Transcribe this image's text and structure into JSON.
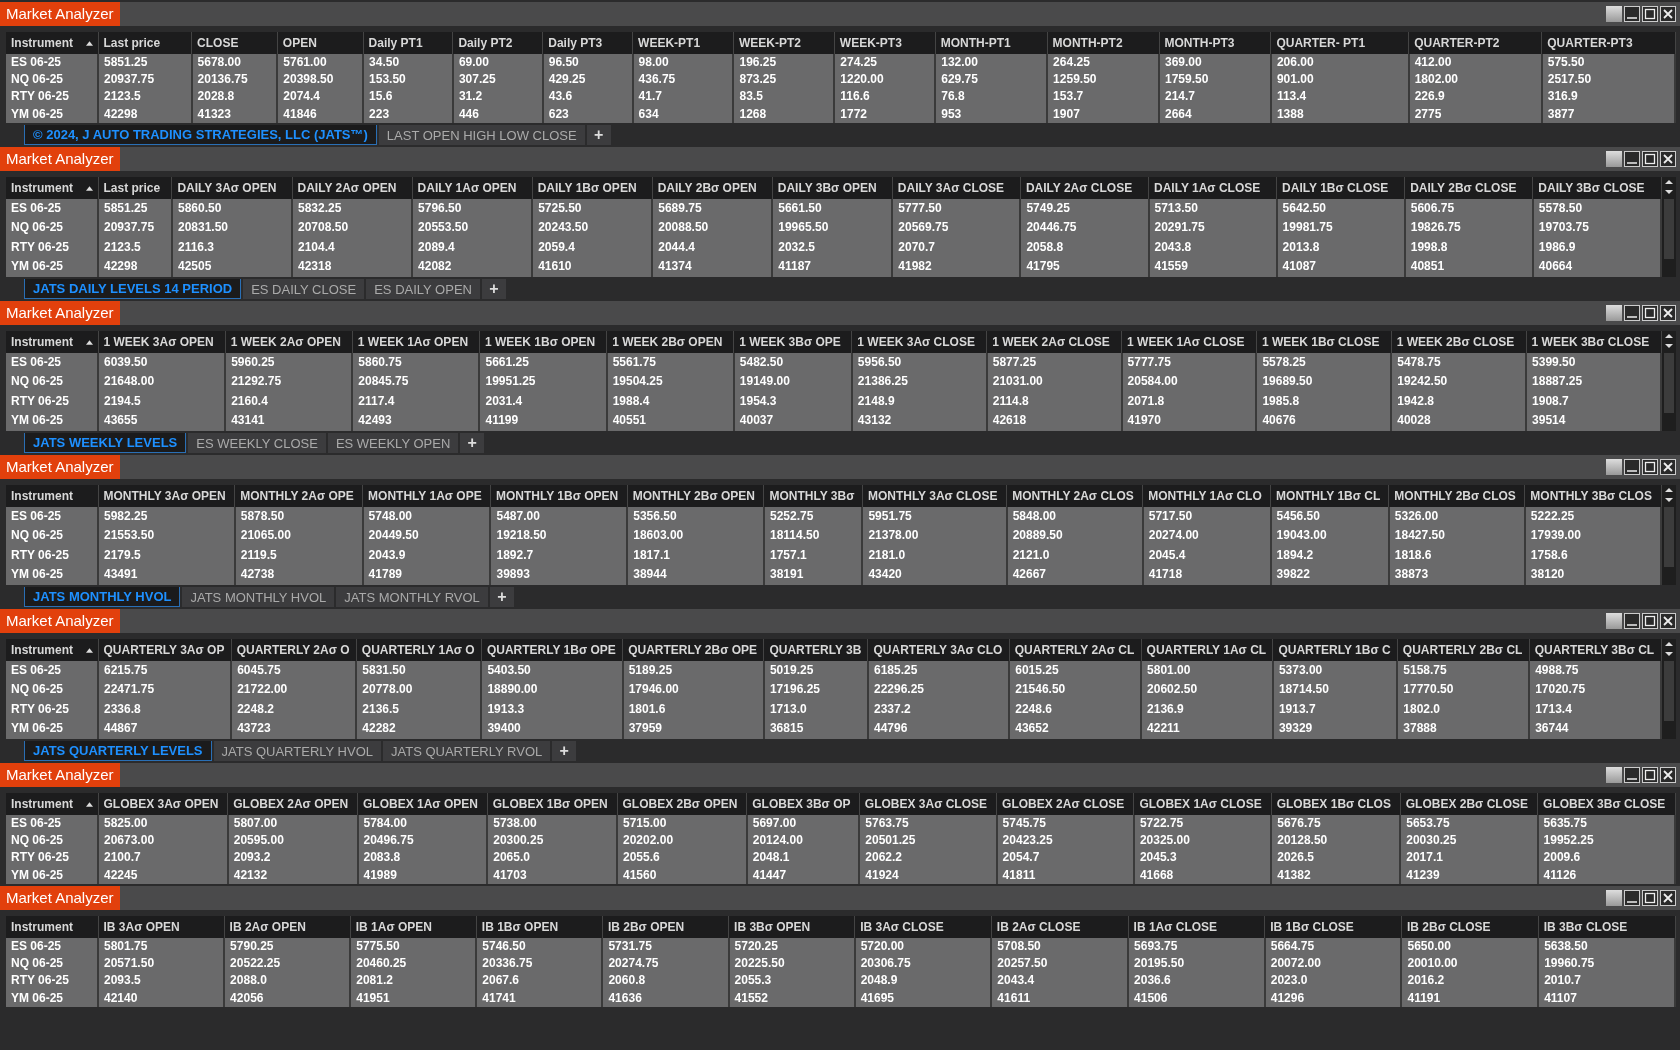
{
  "panels": [
    {
      "title": "Market Analyzer",
      "sorted": true,
      "scrollbar": false,
      "columns": [
        "Instrument",
        "Last price",
        "CLOSE",
        "OPEN",
        "Daily PT1",
        "Daily PT2",
        "Daily PT3",
        "WEEK-PT1",
        "WEEK-PT2",
        "WEEK-PT3",
        "MONTH-PT1",
        "MONTH-PT2",
        "MONTH-PT3",
        "QUARTER- PT1",
        "QUARTER-PT2",
        "QUARTER-PT3"
      ],
      "rows": [
        [
          "ES 06-25",
          "5851.25",
          "5678.00",
          "5761.00",
          "34.50",
          "69.00",
          "96.50",
          "98.00",
          "196.25",
          "274.25",
          "132.00",
          "264.25",
          "369.00",
          "206.00",
          "412.00",
          "575.50"
        ],
        [
          "NQ 06-25",
          "20937.75",
          "20136.75",
          "20398.50",
          "153.50",
          "307.25",
          "429.25",
          "436.75",
          "873.25",
          "1220.00",
          "629.75",
          "1259.50",
          "1759.50",
          "901.00",
          "1802.00",
          "2517.50"
        ],
        [
          "RTY 06-25",
          "2123.5",
          "2028.8",
          "2074.4",
          "15.6",
          "31.2",
          "43.6",
          "41.7",
          "83.5",
          "116.6",
          "76.8",
          "153.7",
          "214.7",
          "113.4",
          "226.9",
          "316.9"
        ],
        [
          "YM 06-25",
          "42298",
          "41323",
          "41846",
          "223",
          "446",
          "623",
          "634",
          "1268",
          "1772",
          "953",
          "1907",
          "2664",
          "1388",
          "2775",
          "3877"
        ]
      ],
      "tabs": [
        {
          "label": "© 2024, J AUTO TRADING STRATEGIES, LLC (JATS™)",
          "selected": true
        },
        {
          "label": "LAST OPEN HIGH LOW CLOSE",
          "selected": false
        }
      ],
      "add_tab": "+"
    },
    {
      "title": "Market Analyzer",
      "sorted": true,
      "scrollbar": true,
      "columns": [
        "Instrument",
        "Last price",
        "DAILY 3Aσ OPEN",
        "DAILY 2Aσ OPEN",
        "DAILY 1Aσ OPEN",
        "DAILY 1Bσ OPEN",
        "DAILY 2Bσ OPEN",
        "DAILY 3Bσ OPEN",
        "DAILY 3Aσ CLOSE",
        "DAILY 2Aσ CLOSE",
        "DAILY 1Aσ CLOSE",
        "DAILY 1Bσ CLOSE",
        "DAILY 2Bσ CLOSE",
        "DAILY 3Bσ CLOSE"
      ],
      "rows": [
        [
          "ES 06-25",
          "5851.25",
          "5860.50",
          "5832.25",
          "5796.50",
          "5725.50",
          "5689.75",
          "5661.50",
          "5777.50",
          "5749.25",
          "5713.50",
          "5642.50",
          "5606.75",
          "5578.50"
        ],
        [
          "NQ 06-25",
          "20937.75",
          "20831.50",
          "20708.50",
          "20553.50",
          "20243.50",
          "20088.50",
          "19965.50",
          "20569.75",
          "20446.75",
          "20291.75",
          "19981.75",
          "19826.75",
          "19703.75"
        ],
        [
          "RTY 06-25",
          "2123.5",
          "2116.3",
          "2104.4",
          "2089.4",
          "2059.4",
          "2044.4",
          "2032.5",
          "2070.7",
          "2058.8",
          "2043.8",
          "2013.8",
          "1998.8",
          "1986.9"
        ],
        [
          "YM 06-25",
          "42298",
          "42505",
          "42318",
          "42082",
          "41610",
          "41374",
          "41187",
          "41982",
          "41795",
          "41559",
          "41087",
          "40851",
          "40664"
        ]
      ],
      "tabs": [
        {
          "label": "JATS DAILY LEVELS 14 PERIOD",
          "selected": true
        },
        {
          "label": "ES DAILY CLOSE",
          "selected": false
        },
        {
          "label": "ES DAILY OPEN",
          "selected": false
        }
      ],
      "add_tab": "+"
    },
    {
      "title": "Market Analyzer",
      "sorted": true,
      "scrollbar": true,
      "columns": [
        "Instrument",
        "1 WEEK 3Aσ OPEN",
        "1 WEEK 2Aσ OPEN",
        "1 WEEK 1Aσ OPEN",
        "1 WEEK 1Bσ OPEN",
        "1 WEEK 2Bσ OPEN",
        "1 WEEK 3Bσ OPE",
        "1 WEEK 3Aσ CLOSE",
        "1 WEEK 2Aσ CLOSE",
        "1 WEEK 1Aσ CLOSE",
        "1 WEEK 1Bσ CLOSE",
        "1 WEEK 2Bσ CLOSE",
        "1 WEEK 3Bσ CLOSE"
      ],
      "rows": [
        [
          "ES 06-25",
          "6039.50",
          "5960.25",
          "5860.75",
          "5661.25",
          "5561.75",
          "5482.50",
          "5956.50",
          "5877.25",
          "5777.75",
          "5578.25",
          "5478.75",
          "5399.50"
        ],
        [
          "NQ 06-25",
          "21648.00",
          "21292.75",
          "20845.75",
          "19951.25",
          "19504.25",
          "19149.00",
          "21386.25",
          "21031.00",
          "20584.00",
          "19689.50",
          "19242.50",
          "18887.25"
        ],
        [
          "RTY 06-25",
          "2194.5",
          "2160.4",
          "2117.4",
          "2031.4",
          "1988.4",
          "1954.3",
          "2148.9",
          "2114.8",
          "2071.8",
          "1985.8",
          "1942.8",
          "1908.7"
        ],
        [
          "YM 06-25",
          "43655",
          "43141",
          "42493",
          "41199",
          "40551",
          "40037",
          "43132",
          "42618",
          "41970",
          "40676",
          "40028",
          "39514"
        ]
      ],
      "tabs": [
        {
          "label": "JATS WEEKLY LEVELS",
          "selected": true
        },
        {
          "label": "ES WEEKLY CLOSE",
          "selected": false
        },
        {
          "label": "ES WEEKLY OPEN",
          "selected": false
        }
      ],
      "add_tab": "+"
    },
    {
      "title": "Market Analyzer",
      "sorted": false,
      "scrollbar": true,
      "columns": [
        "Instrument",
        "MONTHLY 3Aσ OPEN",
        "MONTHLY 2Aσ OPE",
        "MONTHLY 1Aσ OPE",
        "MONTHLY 1Bσ OPEN",
        "MONTHLY 2Bσ OPEN",
        "MONTHLY 3Bσ",
        "MONTHLY 3Aσ CLOSE",
        "MONTHLY 2Aσ CLOS",
        "MONTHLY 1Aσ CLO",
        "MONTHLY 1Bσ CL",
        "MONTHLY 2Bσ CLOS",
        "MONTHLY 3Bσ CLOS"
      ],
      "rows": [
        [
          "ES 06-25",
          "5982.25",
          "5878.50",
          "5748.00",
          "5487.00",
          "5356.50",
          "5252.75",
          "5951.75",
          "5848.00",
          "5717.50",
          "5456.50",
          "5326.00",
          "5222.25"
        ],
        [
          "NQ 06-25",
          "21553.50",
          "21065.00",
          "20449.50",
          "19218.50",
          "18603.00",
          "18114.50",
          "21378.00",
          "20889.50",
          "20274.00",
          "19043.00",
          "18427.50",
          "17939.00"
        ],
        [
          "RTY 06-25",
          "2179.5",
          "2119.5",
          "2043.9",
          "1892.7",
          "1817.1",
          "1757.1",
          "2181.0",
          "2121.0",
          "2045.4",
          "1894.2",
          "1818.6",
          "1758.6"
        ],
        [
          "YM 06-25",
          "43491",
          "42738",
          "41789",
          "39893",
          "38944",
          "38191",
          "43420",
          "42667",
          "41718",
          "39822",
          "38873",
          "38120"
        ]
      ],
      "tabs": [
        {
          "label": "JATS MONTHLY HVOL",
          "selected": true
        },
        {
          "label": "JATS MONTHLY HVOL",
          "selected": false
        },
        {
          "label": "JATS MONTHLY RVOL",
          "selected": false
        }
      ],
      "add_tab": "+"
    },
    {
      "title": "Market Analyzer",
      "sorted": true,
      "scrollbar": true,
      "columns": [
        "Instrument",
        "QUARTERLY 3Aσ OP",
        "QUARTERLY 2Aσ O",
        "QUARTERLY 1Aσ O",
        "QUARTERLY 1Bσ OPE",
        "QUARTERLY 2Bσ OPE",
        "QUARTERLY 3B",
        "QUARTERLY 3Aσ CLO",
        "QUARTERLY 2Aσ CL",
        "QUARTERLY 1Aσ CL",
        "QUARTERLY 1Bσ C",
        "QUARTERLY 2Bσ CL",
        "QUARTERLY 3Bσ CL"
      ],
      "rows": [
        [
          "ES 06-25",
          "6215.75",
          "6045.75",
          "5831.50",
          "5403.50",
          "5189.25",
          "5019.25",
          "6185.25",
          "6015.25",
          "5801.00",
          "5373.00",
          "5158.75",
          "4988.75"
        ],
        [
          "NQ 06-25",
          "22471.75",
          "21722.00",
          "20778.00",
          "18890.00",
          "17946.00",
          "17196.25",
          "22296.25",
          "21546.50",
          "20602.50",
          "18714.50",
          "17770.50",
          "17020.75"
        ],
        [
          "RTY 06-25",
          "2336.8",
          "2248.2",
          "2136.5",
          "1913.3",
          "1801.6",
          "1713.0",
          "2337.2",
          "2248.6",
          "2136.9",
          "1913.7",
          "1802.0",
          "1713.4"
        ],
        [
          "YM 06-25",
          "44867",
          "43723",
          "42282",
          "39400",
          "37959",
          "36815",
          "44796",
          "43652",
          "42211",
          "39329",
          "37888",
          "36744"
        ]
      ],
      "tabs": [
        {
          "label": "JATS QUARTERLY LEVELS",
          "selected": true
        },
        {
          "label": "JATS QUARTERLY HVOL",
          "selected": false
        },
        {
          "label": "JATS QUARTERLY RVOL",
          "selected": false
        }
      ],
      "add_tab": "+"
    },
    {
      "title": "Market Analyzer",
      "sorted": true,
      "scrollbar": false,
      "columns": [
        "Instrument",
        "GLOBEX 3Aσ OPEN",
        "GLOBEX 2Aσ OPEN",
        "GLOBEX 1Aσ OPEN",
        "GLOBEX 1Bσ OPEN",
        "GLOBEX 2Bσ OPEN",
        "GLOBEX 3Bσ OP",
        "GLOBEX 3Aσ CLOSE",
        "GLOBEX 2Aσ CLOSE",
        "GLOBEX 1Aσ CLOSE",
        "GLOBEX 1Bσ CLOS",
        "GLOBEX 2Bσ CLOSE",
        "GLOBEX 3Bσ CLOSE"
      ],
      "rows": [
        [
          "ES 06-25",
          "5825.00",
          "5807.00",
          "5784.00",
          "5738.00",
          "5715.00",
          "5697.00",
          "5763.75",
          "5745.75",
          "5722.75",
          "5676.75",
          "5653.75",
          "5635.75"
        ],
        [
          "NQ 06-25",
          "20673.00",
          "20595.00",
          "20496.75",
          "20300.25",
          "20202.00",
          "20124.00",
          "20501.25",
          "20423.25",
          "20325.00",
          "20128.50",
          "20030.25",
          "19952.25"
        ],
        [
          "RTY 06-25",
          "2100.7",
          "2093.2",
          "2083.8",
          "2065.0",
          "2055.6",
          "2048.1",
          "2062.2",
          "2054.7",
          "2045.3",
          "2026.5",
          "2017.1",
          "2009.6"
        ],
        [
          "YM 06-25",
          "42245",
          "42132",
          "41989",
          "41703",
          "41560",
          "41447",
          "41924",
          "41811",
          "41668",
          "41382",
          "41239",
          "41126"
        ]
      ]
    },
    {
      "title": "Market Analyzer",
      "sorted": false,
      "scrollbar": false,
      "columns": [
        "Instrument",
        "IB 3Aσ OPEN",
        "IB 2Aσ OPEN",
        "IB 1Aσ OPEN",
        "IB 1Bσ OPEN",
        "IB 2Bσ OPEN",
        "IB 3Bσ OPEN",
        "IB 3Aσ CLOSE",
        "IB 2Aσ CLOSE",
        "IB 1Aσ CLOSE",
        "IB 1Bσ CLOSE",
        "IB 2Bσ CLOSE",
        "IB 3Bσ CLOSE"
      ],
      "rows": [
        [
          "ES 06-25",
          "5801.75",
          "5790.25",
          "5775.50",
          "5746.50",
          "5731.75",
          "5720.25",
          "5720.00",
          "5708.50",
          "5693.75",
          "5664.75",
          "5650.00",
          "5638.50"
        ],
        [
          "NQ 06-25",
          "20571.50",
          "20522.25",
          "20460.25",
          "20336.75",
          "20274.75",
          "20225.50",
          "20306.75",
          "20257.50",
          "20195.50",
          "20072.00",
          "20010.00",
          "19960.75"
        ],
        [
          "RTY 06-25",
          "2093.5",
          "2088.0",
          "2081.2",
          "2067.6",
          "2060.8",
          "2055.3",
          "2048.9",
          "2043.4",
          "2036.6",
          "2023.0",
          "2016.2",
          "2010.7"
        ],
        [
          "YM 06-25",
          "42140",
          "42056",
          "41951",
          "41741",
          "41636",
          "41552",
          "41695",
          "41611",
          "41506",
          "41296",
          "41191",
          "41107"
        ]
      ]
    }
  ]
}
